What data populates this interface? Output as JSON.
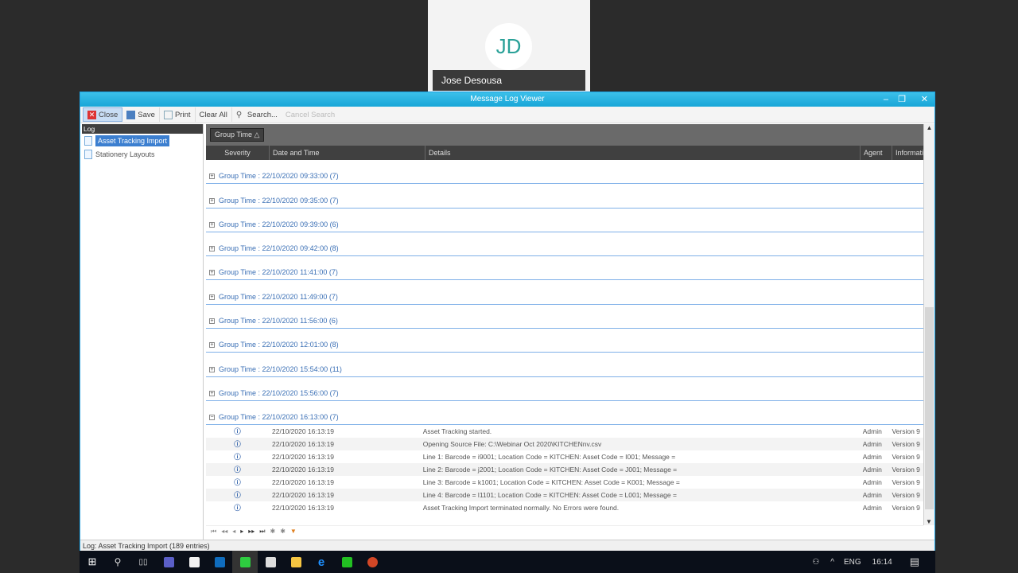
{
  "video": {
    "initials": "JD",
    "name": "Jose Desousa"
  },
  "window": {
    "title": "Message Log Viewer"
  },
  "toolbar": {
    "close": "Close",
    "save": "Save",
    "print": "Print",
    "clear_all": "Clear All",
    "search": "Search...",
    "cancel_search": "Cancel Search"
  },
  "left": {
    "header": "Log",
    "items": [
      {
        "label": "Asset Tracking Import",
        "selected": true
      },
      {
        "label": "Stationery Layouts",
        "selected": false
      }
    ]
  },
  "grid": {
    "group_chip": "Group Time",
    "columns": {
      "severity": "Severity",
      "date": "Date and Time",
      "details": "Details",
      "agent": "Agent",
      "info": "Informati"
    },
    "groups": [
      "Group Time : 22/10/2020 09:33:00 (7)",
      "Group Time : 22/10/2020 09:35:00 (7)",
      "Group Time : 22/10/2020 09:39:00 (6)",
      "Group Time : 22/10/2020 09:42:00 (8)",
      "Group Time : 22/10/2020 11:41:00 (7)",
      "Group Time : 22/10/2020 11:49:00 (7)",
      "Group Time : 22/10/2020 11:56:00 (6)",
      "Group Time : 22/10/2020 12:01:00 (8)",
      "Group Time : 22/10/2020 15:54:00 (11)",
      "Group Time : 22/10/2020 15:56:00 (7)",
      "Group Time : 22/10/2020 16:13:00 (7)"
    ],
    "rows": [
      {
        "date": "22/10/2020 16:13:19",
        "details": "Asset Tracking started.",
        "agent": "Admin",
        "info": "Version 9"
      },
      {
        "date": "22/10/2020 16:13:19",
        "details": "Opening Source File: C:\\Webinar Oct 2020\\KITCHENnv.csv",
        "agent": "Admin",
        "info": "Version 9"
      },
      {
        "date": "22/10/2020 16:13:19",
        "details": "Line 1: Barcode = i9001; Location Code = KITCHEN: Asset Code = I001; Message =",
        "agent": "Admin",
        "info": "Version 9"
      },
      {
        "date": "22/10/2020 16:13:19",
        "details": "Line 2: Barcode = j2001; Location Code = KITCHEN: Asset Code = J001; Message =",
        "agent": "Admin",
        "info": "Version 9"
      },
      {
        "date": "22/10/2020 16:13:19",
        "details": "Line 3: Barcode = k1001; Location Code = KITCHEN: Asset Code = K001; Message =",
        "agent": "Admin",
        "info": "Version 9"
      },
      {
        "date": "22/10/2020 16:13:19",
        "details": "Line 4: Barcode = l1101; Location Code = KITCHEN: Asset Code = L001; Message =",
        "agent": "Admin",
        "info": "Version 9"
      },
      {
        "date": "22/10/2020 16:13:19",
        "details": "Asset Tracking Import terminated normally. No Errors were found.",
        "agent": "Admin",
        "info": "Version 9"
      }
    ]
  },
  "status": "Log: Asset Tracking Import (189 entries)",
  "taskbar": {
    "lang": "ENG",
    "time": "16:14"
  }
}
